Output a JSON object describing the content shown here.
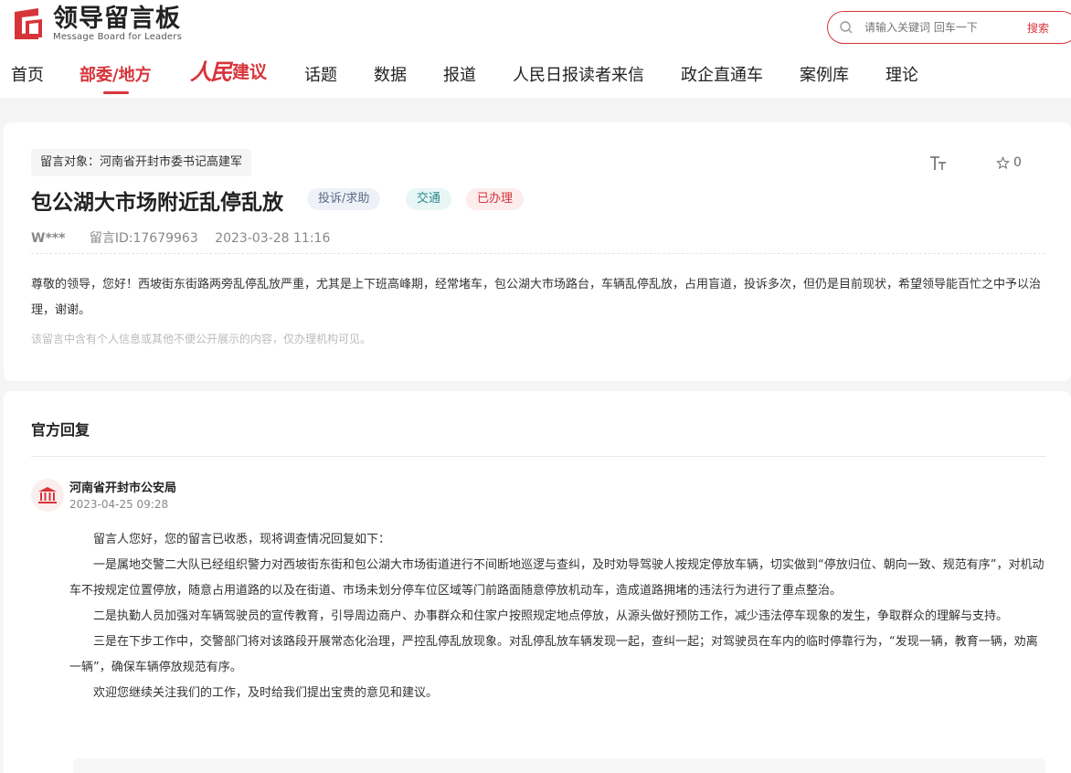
{
  "header": {
    "logo_title": "领导留言板",
    "logo_subtitle": "Message Board for Leaders",
    "search_placeholder": "请输入关键词 回车一下",
    "search_button": "搜索"
  },
  "nav": {
    "items": [
      "首页",
      "部委/地方",
      "话题",
      "数据",
      "报道",
      "人民日报读者来信",
      "政企直通车",
      "案例库",
      "理论"
    ],
    "brand_script": "人民",
    "brand_text": "建议",
    "active": "部委/地方"
  },
  "message": {
    "target": "留言对象：河南省开封市委书记高建军",
    "title": "包公湖大市场附近乱停乱放",
    "badges": [
      "投诉/求助",
      "交通",
      "已办理"
    ],
    "author": "W***",
    "message_id": "留言ID:17679963",
    "time": "2023-03-28 11:16",
    "star_count": "0",
    "body": "尊敬的领导，您好！西坡街东街路两旁乱停乱放严重，尤其是上下班高峰期，经常堵车，包公湖大市场路台，车辆乱停乱放，占用盲道，投诉多次，但仍是目前现状，希望领导能百忙之中予以治理，谢谢。",
    "note": "该留言中含有个人信息或其他不便公开展示的内容，仅办理机构可见。"
  },
  "reply": {
    "heading": "官方回复",
    "org_name": "河南省开封市公安局",
    "time": "2023-04-25 09:28",
    "paragraphs": [
      "留言人您好，您的留言已收悉，现将调查情况回复如下：",
      "一是属地交警二大队已经组织警力对西坡街东街和包公湖大市场街道进行不间断地巡逻与查纠，及时劝导驾驶人按规定停放车辆，切实做到“停放归位、朝向一致、规范有序”，对机动车不按规定位置停放，随意占用道路的以及在街道、市场未划分停车位区域等门前路面随意停放机动车，造成道路拥堵的违法行为进行了重点整治。",
      "二是执勤人员加强对车辆驾驶员的宣传教育，引导周边商户、办事群众和住家户按照规定地点停放，从源头做好预防工作，减少违法停车现象的发生，争取群众的理解与支持。",
      "三是在下步工作中，交警部门将对该路段开展常态化治理，严控乱停乱放现象。对乱停乱放车辆发现一起，查纠一起；对驾驶员在车内的临时停靠行为，“发现一辆，教育一辆，劝离一辆”，确保车辆停放规范有序。",
      "欢迎您继续关注我们的工作，及时给我们提出宝贵的意见和建议。"
    ]
  },
  "colors": {
    "accent": "#d7343a",
    "page_bg": "#f5f5f5"
  }
}
